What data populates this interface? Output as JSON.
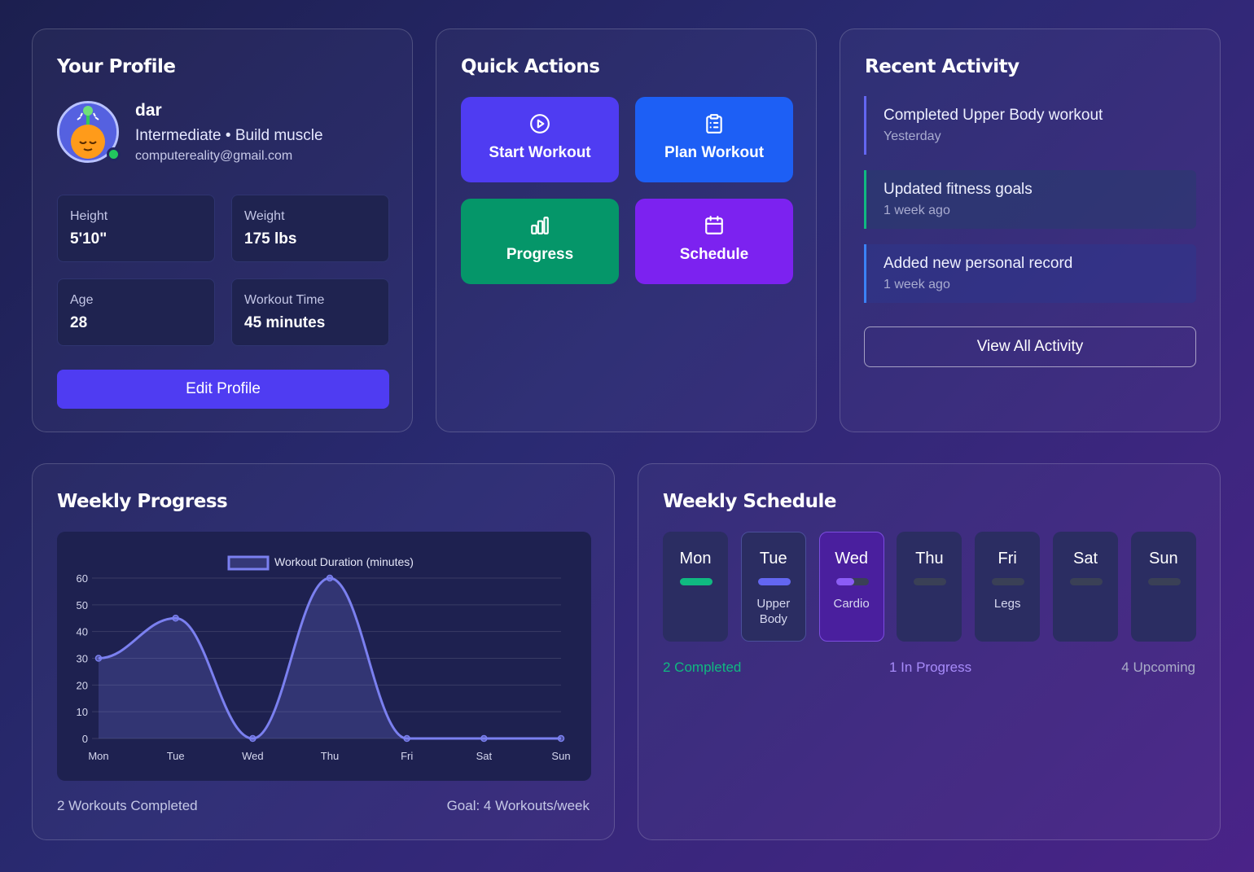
{
  "profile": {
    "title": "Your Profile",
    "name": "dar",
    "level": "Intermediate",
    "goal": "Build muscle",
    "sub": "Intermediate • Build muscle",
    "email": "computereality@gmail.com",
    "stats": [
      {
        "label": "Height",
        "value": "5'10\""
      },
      {
        "label": "Weight",
        "value": "175 lbs"
      },
      {
        "label": "Age",
        "value": "28"
      },
      {
        "label": "Workout Time",
        "value": "45 minutes"
      }
    ],
    "edit_label": "Edit Profile",
    "online_color": "#22c55e"
  },
  "quick_actions": {
    "title": "Quick Actions",
    "items": [
      {
        "label": "Start Workout",
        "icon": "play-circle-icon",
        "color": "#4f3cf2"
      },
      {
        "label": "Plan Workout",
        "icon": "clipboard-list-icon",
        "color": "#1d5ff5"
      },
      {
        "label": "Progress",
        "icon": "bar-chart-icon",
        "color": "#059669"
      },
      {
        "label": "Schedule",
        "icon": "calendar-icon",
        "color": "#7c22f0"
      }
    ]
  },
  "activity": {
    "title": "Recent Activity",
    "items": [
      {
        "title": "Completed Upper Body workout",
        "time": "Yesterday",
        "accent": "#6366f1"
      },
      {
        "title": "Updated fitness goals",
        "time": "1 week ago",
        "accent": "#10b981"
      },
      {
        "title": "Added new personal record",
        "time": "1 week ago",
        "accent": "#3b82f6"
      }
    ],
    "view_all_label": "View All Activity"
  },
  "weekly_progress": {
    "title": "Weekly Progress",
    "completed_text": "2 Workouts Completed",
    "goal_text": "Goal: 4 Workouts/week"
  },
  "chart_data": {
    "type": "area",
    "categories": [
      "Mon",
      "Tue",
      "Wed",
      "Thu",
      "Fri",
      "Sat",
      "Sun"
    ],
    "series": [
      {
        "name": "Workout Duration (minutes)",
        "values": [
          30,
          45,
          0,
          60,
          0,
          0,
          0
        ],
        "color": "#7b80f0"
      }
    ],
    "ylim": [
      0,
      60
    ],
    "yticks": [
      0,
      10,
      20,
      30,
      40,
      50,
      60
    ],
    "grid": true,
    "legend": "top-center"
  },
  "schedule": {
    "title": "Weekly Schedule",
    "days": [
      {
        "name": "Mon",
        "label": "",
        "status": "completed",
        "fill": 1.0
      },
      {
        "name": "Tue",
        "label": "Upper Body",
        "status": "completed",
        "fill": 1.0
      },
      {
        "name": "Wed",
        "label": "Cardio",
        "status": "in-progress",
        "fill": 0.55
      },
      {
        "name": "Thu",
        "label": "",
        "status": "upcoming",
        "fill": 0
      },
      {
        "name": "Fri",
        "label": "Legs",
        "status": "upcoming",
        "fill": 0
      },
      {
        "name": "Sat",
        "label": "",
        "status": "upcoming",
        "fill": 0
      },
      {
        "name": "Sun",
        "label": "",
        "status": "upcoming",
        "fill": 0
      }
    ],
    "completed_text": "2 Completed",
    "in_progress_text": "1 In Progress",
    "upcoming_text": "4 Upcoming",
    "colors": {
      "completed": "#10b981",
      "in_progress": "#8b5cf6",
      "upcoming": "#a9acc8"
    }
  }
}
